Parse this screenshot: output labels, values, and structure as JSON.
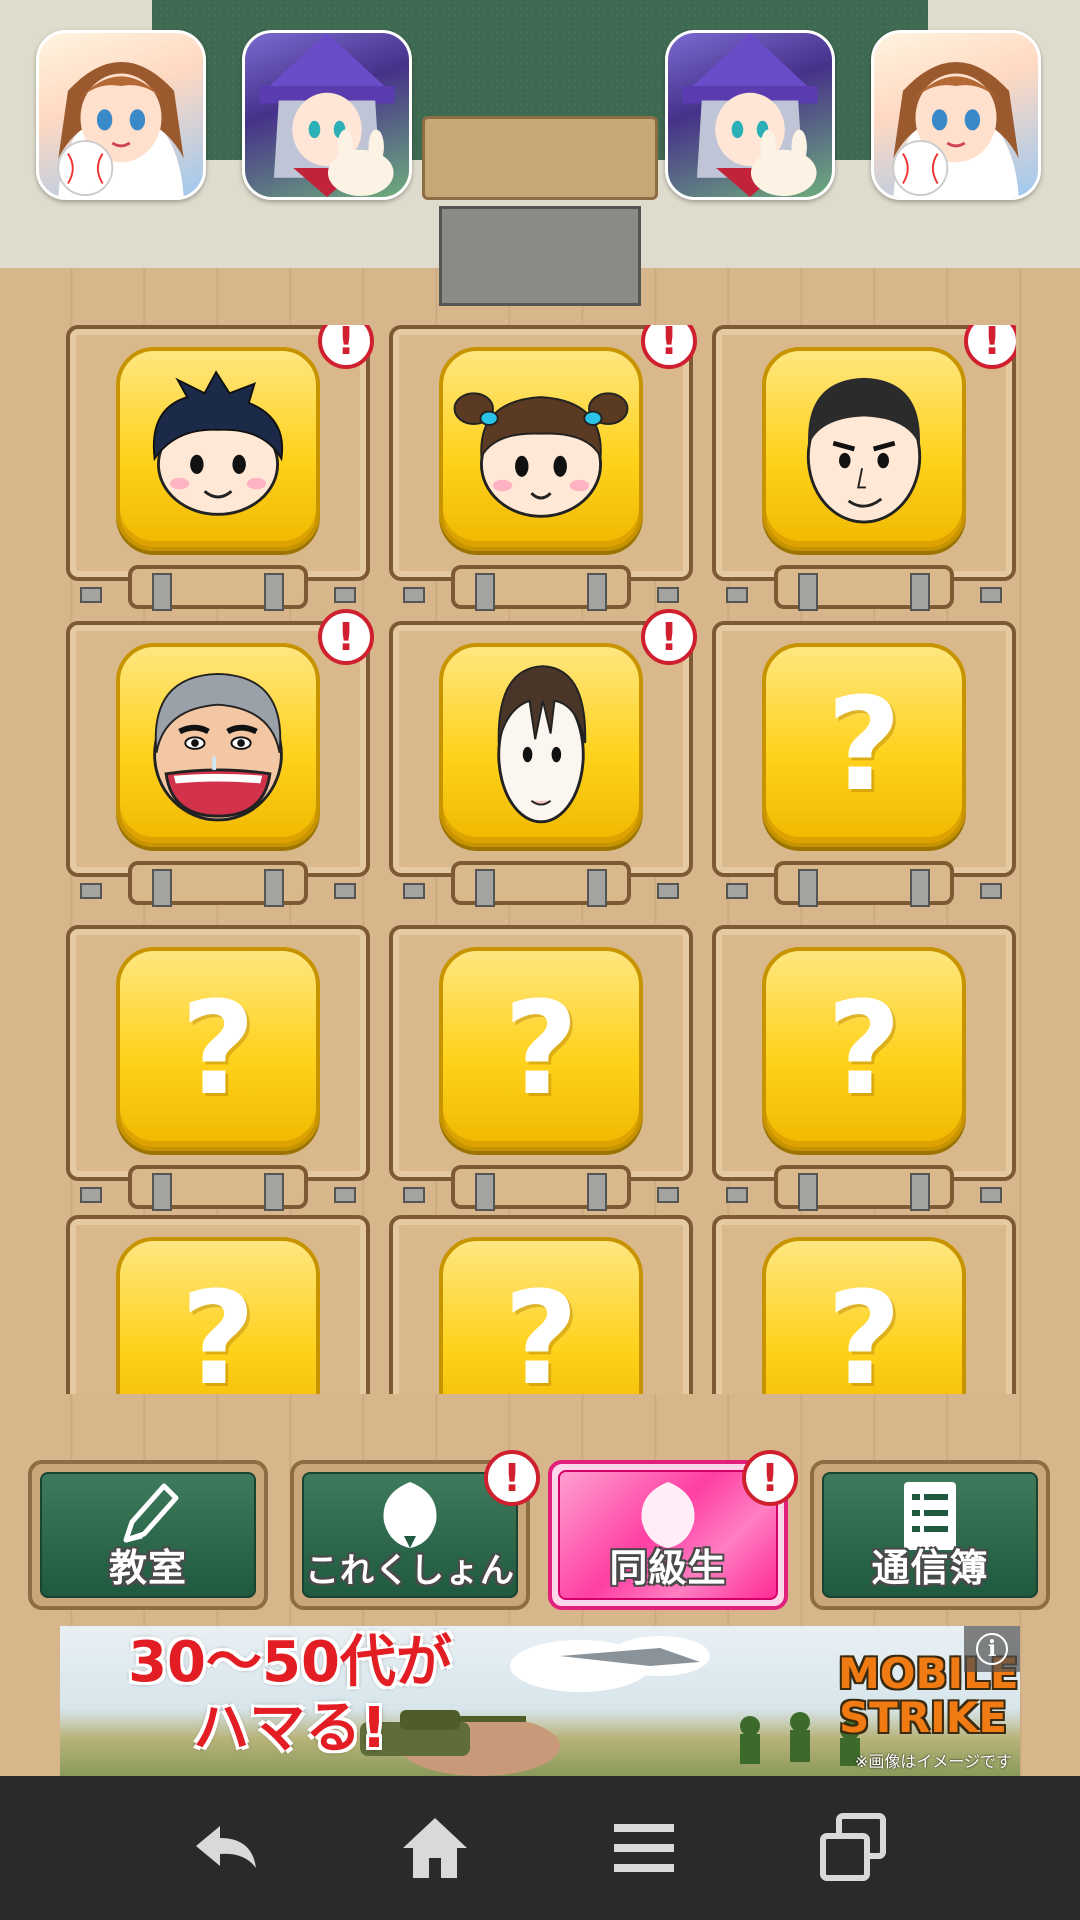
{
  "screen": {
    "section": "同級生",
    "unknown_symbol": "?",
    "alert_symbol": "!"
  },
  "header": {
    "banners": [
      {
        "icon": "baseball-girl-icon"
      },
      {
        "icon": "witch-rabbit-icon"
      },
      {
        "icon": "witch-rabbit-icon"
      },
      {
        "icon": "baseball-girl-icon"
      }
    ]
  },
  "classmates": [
    {
      "icon": "boy-face-icon",
      "unlocked": true,
      "alert": true
    },
    {
      "icon": "pigtail-girl-face-icon",
      "unlocked": true,
      "alert": true
    },
    {
      "icon": "crewcut-boy-face-icon",
      "unlocked": true,
      "alert": true
    },
    {
      "icon": "old-man-face-icon",
      "unlocked": true,
      "alert": true
    },
    {
      "icon": "pale-boy-face-icon",
      "unlocked": true,
      "alert": true
    },
    {
      "icon": "question-icon",
      "unlocked": false,
      "alert": false
    },
    {
      "icon": "question-icon",
      "unlocked": false,
      "alert": false
    },
    {
      "icon": "question-icon",
      "unlocked": false,
      "alert": false
    },
    {
      "icon": "question-icon",
      "unlocked": false,
      "alert": false
    },
    {
      "icon": "question-icon",
      "unlocked": false,
      "alert": false
    },
    {
      "icon": "question-icon",
      "unlocked": false,
      "alert": false
    },
    {
      "icon": "question-icon",
      "unlocked": false,
      "alert": false
    }
  ],
  "menu": {
    "classroom": {
      "label": "教室",
      "icon": "pencil-icon",
      "alert": false
    },
    "collection": {
      "label": "これくしょん",
      "icon": "egg-icon",
      "alert": true
    },
    "classmates": {
      "label": "同級生",
      "icon": "egg-icon",
      "alert": true,
      "active": true
    },
    "report_card": {
      "label": "通信簿",
      "icon": "report-list-icon",
      "alert": false
    }
  },
  "ad": {
    "headline_line1": "30〜50代が",
    "headline_line2": "ハマる!",
    "brand_line1": "MOBILE",
    "brand_line2": "STRIKE",
    "note": "※画像はイメージです",
    "info_symbol": "i"
  },
  "navbar": {
    "buttons": [
      "back-icon",
      "home-icon",
      "menu-icon",
      "recent-apps-icon"
    ]
  },
  "colors": {
    "card_yellow": "#ffd21c",
    "menu_green": "#1f5a3f",
    "menu_pink": "#ff3fa2",
    "alert_red": "#d01f2e",
    "navbar": "#2a2a2b"
  }
}
